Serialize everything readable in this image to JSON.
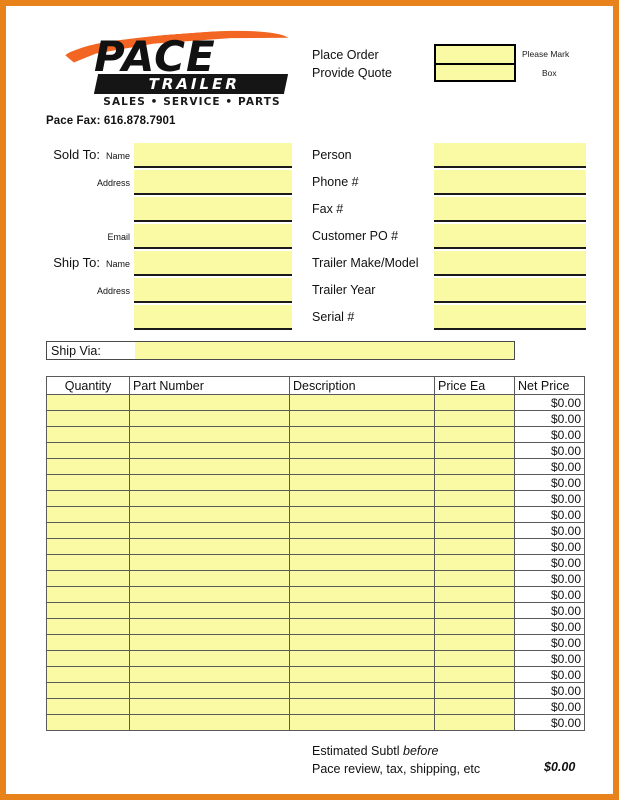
{
  "page": {
    "border_color": "#E8821B",
    "field_fill_color": "#FAFAA5"
  },
  "logo": {
    "brand": "PACE",
    "sub_brand": "TRAILER",
    "tagline": "SALES • SERVICE • PARTS"
  },
  "header": {
    "fax_line": "Pace Fax: 616.878.7901",
    "place_order_label": "Place Order",
    "provide_quote_label": "Provide Quote",
    "please_mark_note": "Please Mark",
    "box_note": "Box"
  },
  "left_fields": [
    {
      "big_label": "Sold To:",
      "small_label": "Name",
      "value": ""
    },
    {
      "big_label": "",
      "small_label": "Address",
      "value": ""
    },
    {
      "big_label": "",
      "small_label": "",
      "value": ""
    },
    {
      "big_label": "",
      "small_label": "Email",
      "value": ""
    },
    {
      "big_label": "Ship To:",
      "small_label": "Name",
      "value": ""
    },
    {
      "big_label": "",
      "small_label": "Address",
      "value": ""
    },
    {
      "big_label": "",
      "small_label": "",
      "value": ""
    }
  ],
  "right_fields": [
    {
      "label": "Person",
      "value": ""
    },
    {
      "label": "Phone #",
      "value": ""
    },
    {
      "label": "Fax #",
      "value": ""
    },
    {
      "label": "Customer PO #",
      "value": ""
    },
    {
      "label": "Trailer Make/Model",
      "value": ""
    },
    {
      "label": "Trailer Year",
      "value": ""
    },
    {
      "label": "Serial #",
      "value": ""
    }
  ],
  "ship_via": {
    "label": "Ship Via:",
    "value": ""
  },
  "items_table": {
    "columns": [
      "Quantity",
      "Part Number",
      "Description",
      "Price Ea",
      "Net Price"
    ],
    "row_count": 21,
    "rows": [
      {
        "quantity": "",
        "part_number": "",
        "description": "",
        "price_ea": "",
        "net_price": "$0.00"
      },
      {
        "quantity": "",
        "part_number": "",
        "description": "",
        "price_ea": "",
        "net_price": "$0.00"
      },
      {
        "quantity": "",
        "part_number": "",
        "description": "",
        "price_ea": "",
        "net_price": "$0.00"
      },
      {
        "quantity": "",
        "part_number": "",
        "description": "",
        "price_ea": "",
        "net_price": "$0.00"
      },
      {
        "quantity": "",
        "part_number": "",
        "description": "",
        "price_ea": "",
        "net_price": "$0.00"
      },
      {
        "quantity": "",
        "part_number": "",
        "description": "",
        "price_ea": "",
        "net_price": "$0.00"
      },
      {
        "quantity": "",
        "part_number": "",
        "description": "",
        "price_ea": "",
        "net_price": "$0.00"
      },
      {
        "quantity": "",
        "part_number": "",
        "description": "",
        "price_ea": "",
        "net_price": "$0.00"
      },
      {
        "quantity": "",
        "part_number": "",
        "description": "",
        "price_ea": "",
        "net_price": "$0.00"
      },
      {
        "quantity": "",
        "part_number": "",
        "description": "",
        "price_ea": "",
        "net_price": "$0.00"
      },
      {
        "quantity": "",
        "part_number": "",
        "description": "",
        "price_ea": "",
        "net_price": "$0.00"
      },
      {
        "quantity": "",
        "part_number": "",
        "description": "",
        "price_ea": "",
        "net_price": "$0.00"
      },
      {
        "quantity": "",
        "part_number": "",
        "description": "",
        "price_ea": "",
        "net_price": "$0.00"
      },
      {
        "quantity": "",
        "part_number": "",
        "description": "",
        "price_ea": "",
        "net_price": "$0.00"
      },
      {
        "quantity": "",
        "part_number": "",
        "description": "",
        "price_ea": "",
        "net_price": "$0.00"
      },
      {
        "quantity": "",
        "part_number": "",
        "description": "",
        "price_ea": "",
        "net_price": "$0.00"
      },
      {
        "quantity": "",
        "part_number": "",
        "description": "",
        "price_ea": "",
        "net_price": "$0.00"
      },
      {
        "quantity": "",
        "part_number": "",
        "description": "",
        "price_ea": "",
        "net_price": "$0.00"
      },
      {
        "quantity": "",
        "part_number": "",
        "description": "",
        "price_ea": "",
        "net_price": "$0.00"
      },
      {
        "quantity": "",
        "part_number": "",
        "description": "",
        "price_ea": "",
        "net_price": "$0.00"
      },
      {
        "quantity": "",
        "part_number": "",
        "description": "",
        "price_ea": "",
        "net_price": "$0.00"
      }
    ]
  },
  "footer": {
    "line1_prefix": "Estimated Subtl ",
    "line1_emphasis": "before",
    "line2": "Pace review, tax, shipping, etc",
    "total": "$0.00"
  }
}
